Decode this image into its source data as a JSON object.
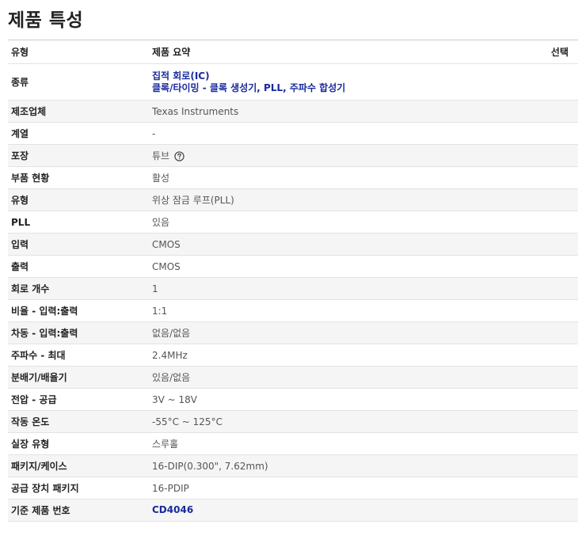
{
  "title": "제품 특성",
  "header": {
    "col_type": "유형",
    "col_summary": "제품 요약",
    "col_select": "선택"
  },
  "rows": [
    {
      "label": "종류",
      "links": [
        "집적 회로(IC)",
        "클록/타이밍 - 클록 생성기, PLL, 주파수 합성기"
      ]
    },
    {
      "label": "제조업체",
      "value": "Texas Instruments"
    },
    {
      "label": "계열",
      "value": "-"
    },
    {
      "label": "포장",
      "value": "튜브",
      "icon": "help-circle-icon"
    },
    {
      "label": "부품 현황",
      "value": "활성"
    },
    {
      "label": "유형",
      "value": "위상 잠금 루프(PLL)"
    },
    {
      "label": "PLL",
      "value": "있음"
    },
    {
      "label": "입력",
      "value": "CMOS"
    },
    {
      "label": "출력",
      "value": "CMOS"
    },
    {
      "label": "회로 개수",
      "value": "1"
    },
    {
      "label": "비율 - 입력:출력",
      "value": "1:1"
    },
    {
      "label": "차동 - 입력:출력",
      "value": "없음/없음"
    },
    {
      "label": "주파수 - 최대",
      "value": "2.4MHz"
    },
    {
      "label": "분배기/배율기",
      "value": "있음/없음"
    },
    {
      "label": "전압 - 공급",
      "value": "3V ~ 18V"
    },
    {
      "label": "작동 온도",
      "value": "-55°C ~ 125°C"
    },
    {
      "label": "실장 유형",
      "value": "스루홀"
    },
    {
      "label": "패키지/케이스",
      "value": "16-DIP(0.300\", 7.62mm)"
    },
    {
      "label": "공급 장치 패키지",
      "value": "16-PDIP"
    },
    {
      "label": "기준 제품 번호",
      "link": "CD4046"
    }
  ],
  "colors": {
    "link": "#1a2a9c",
    "stripe": "#f5f5f5",
    "border": "#e3e3e3"
  }
}
